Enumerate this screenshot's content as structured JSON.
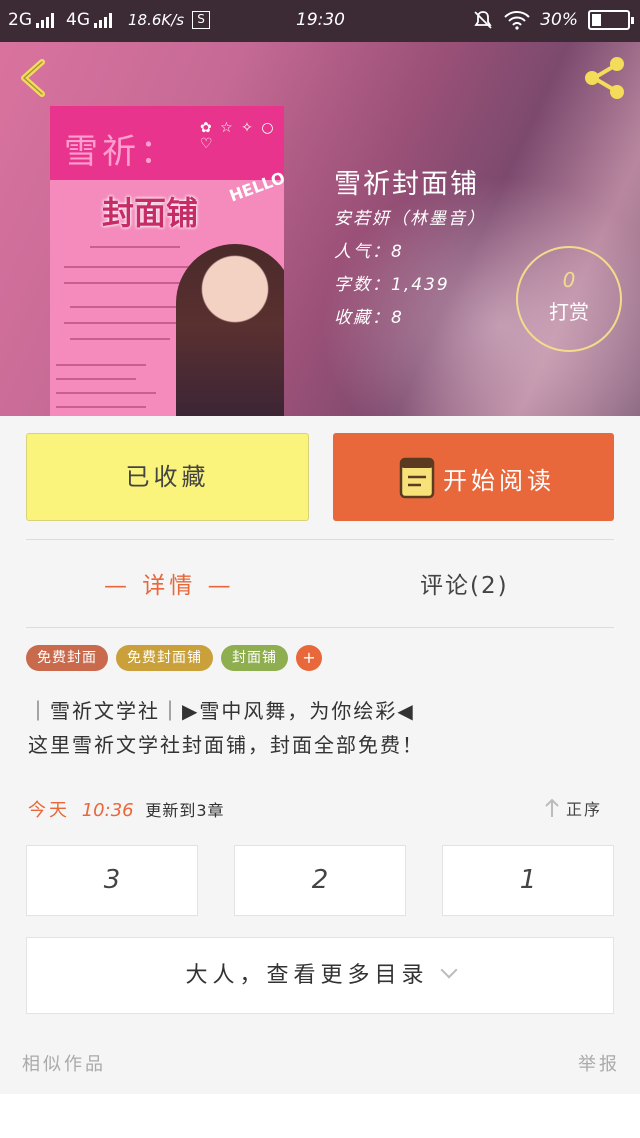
{
  "status_bar": {
    "net1": "2G",
    "net2": "4G",
    "speed": "18.6K/s",
    "s_icon": "S",
    "time": "19:30",
    "battery": "30%"
  },
  "hero": {
    "back_icon": "chevron-left-icon",
    "share_icon": "share-icon",
    "cover": {
      "title": "雪祈：",
      "subtitle": "封面铺",
      "hello": "HELLO!"
    },
    "book_title": "雪祈封面铺",
    "author": "安若妍（林墨音）",
    "popularity": "人气：8",
    "word_count": "字数：1,439",
    "favorites": "收藏：8",
    "tip": {
      "count": "0",
      "label": "打赏"
    }
  },
  "actions": {
    "favorited_label": "已收藏",
    "read_label": "开始阅读",
    "accent": "#e8673b"
  },
  "tabs": {
    "detail": "— 详情 —",
    "comment": "评论(2)"
  },
  "tags": [
    {
      "label": "免费封面",
      "color": "#c96a4d"
    },
    {
      "label": "免费封面铺",
      "color": "#c9a03a"
    },
    {
      "label": "封面铺",
      "color": "#8fae4f"
    }
  ],
  "tag_add": "+",
  "intro": {
    "line1": "｜雪祈文学社｜▶雪中风舞，为你绘彩◀",
    "line2": "这里雪祈文学社封面铺，封面全部免费！"
  },
  "update": {
    "today": "今天",
    "time": "10:36",
    "text": "更新到3章",
    "sort_label": "正序"
  },
  "chapters": [
    "3",
    "2",
    "1"
  ],
  "more_catalog": "大人，查看更多目录",
  "footer": {
    "similar": "相似作品",
    "report": "举报"
  }
}
